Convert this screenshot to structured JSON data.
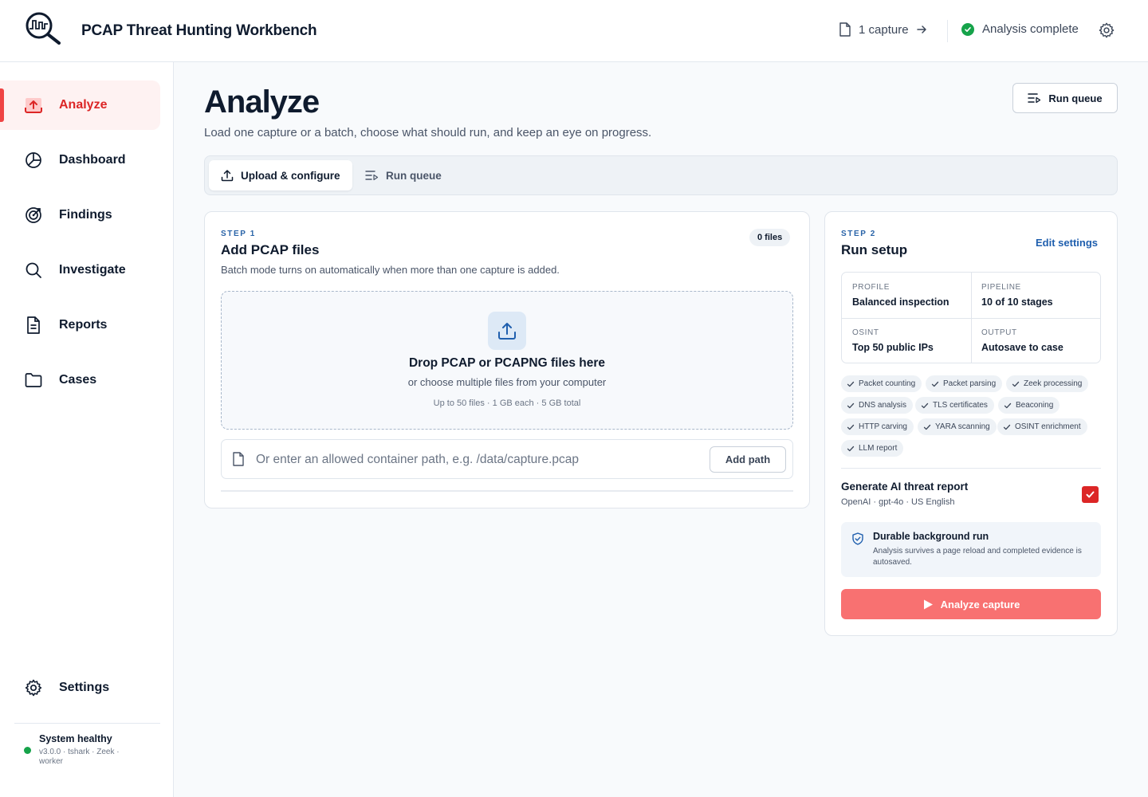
{
  "app": {
    "title": "PCAP Threat Hunting Workbench",
    "capture_count": "1 capture",
    "status": "Analysis complete",
    "colors": {
      "accent": "#dc2626",
      "ok": "#16a34a",
      "link": "#1f5fae"
    }
  },
  "sidebar": {
    "items": [
      {
        "label": "Analyze",
        "icon": "upload-icon",
        "active": true
      },
      {
        "label": "Dashboard",
        "icon": "pie-chart-icon",
        "active": false
      },
      {
        "label": "Findings",
        "icon": "target-icon",
        "active": false
      },
      {
        "label": "Investigate",
        "icon": "search-icon",
        "active": false
      },
      {
        "label": "Reports",
        "icon": "document-icon",
        "active": false
      },
      {
        "label": "Cases",
        "icon": "folder-icon",
        "active": false
      }
    ],
    "settings_label": "Settings",
    "system": {
      "title": "System healthy",
      "meta": "v3.0.0 · tshark · Zeek · worker"
    }
  },
  "page": {
    "title": "Analyze",
    "subtitle": "Load one capture or a batch, choose what should run, and keep an eye on progress.",
    "run_queue_button": "Run queue"
  },
  "tabs": [
    {
      "label": "Upload & configure",
      "active": true
    },
    {
      "label": "Run queue",
      "active": false
    }
  ],
  "step1": {
    "step": "STEP 1",
    "title": "Add PCAP files",
    "subtitle": "Batch mode turns on automatically when more than one capture is added.",
    "files_badge": "0 files",
    "drop_title": "Drop PCAP or PCAPNG files here",
    "drop_sub": "or choose multiple files from your computer",
    "drop_limits": "Up to 50 files · 1 GB each · 5 GB total",
    "path_placeholder": "Or enter an allowed container path, e.g. /data/capture.pcap",
    "path_value": "",
    "add_path_button": "Add path"
  },
  "step2": {
    "step": "STEP 2",
    "title": "Run setup",
    "edit_settings": "Edit settings",
    "grid": [
      {
        "key": "PROFILE",
        "value": "Balanced inspection"
      },
      {
        "key": "PIPELINE",
        "value": "10 of 10 stages"
      },
      {
        "key": "OSINT",
        "value": "Top 50 public IPs"
      },
      {
        "key": "OUTPUT",
        "value": "Autosave to case"
      }
    ],
    "stages": [
      "Packet counting",
      "Packet parsing",
      "Zeek processing",
      "DNS analysis",
      "TLS certificates",
      "Beaconing",
      "HTTP carving",
      "YARA scanning",
      "OSINT enrichment",
      "LLM report"
    ],
    "ai_report": {
      "title": "Generate AI threat report",
      "meta": "OpenAI · gpt-4o · US English",
      "checked": true
    },
    "durable": {
      "title": "Durable background run",
      "text": "Analysis survives a page reload and completed evidence is autosaved."
    },
    "analyze_button": "Analyze capture"
  }
}
